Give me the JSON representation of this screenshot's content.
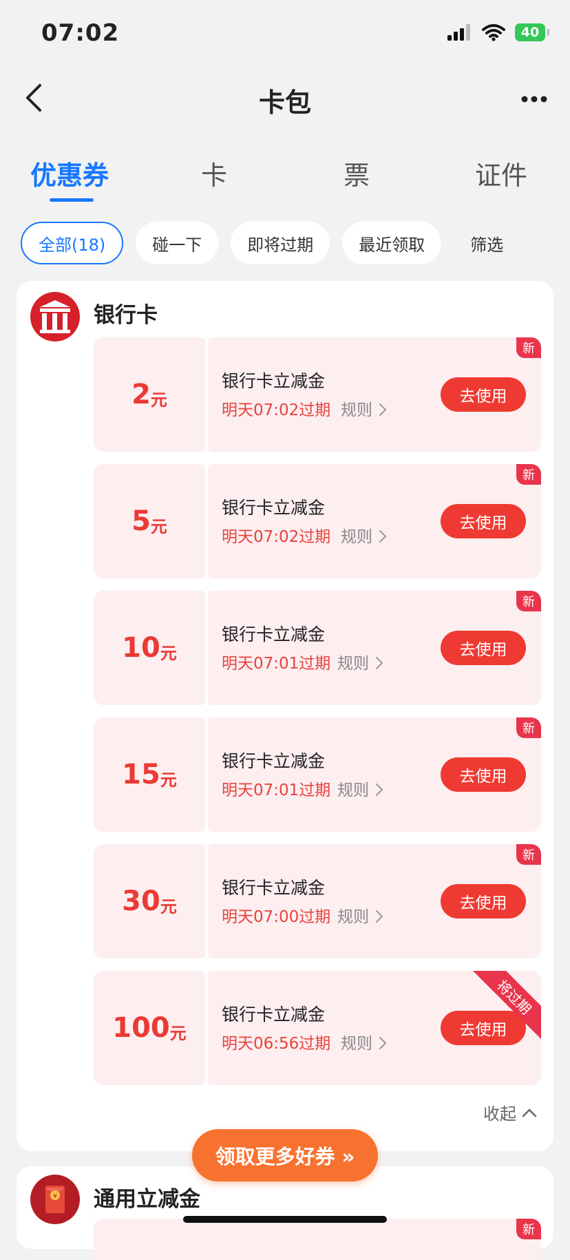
{
  "status": {
    "time": "07:02",
    "battery": "40"
  },
  "nav": {
    "title": "卡包"
  },
  "tabs": [
    {
      "label": "优惠券"
    },
    {
      "label": "卡"
    },
    {
      "label": "票"
    },
    {
      "label": "证件"
    }
  ],
  "filters": [
    {
      "label": "全部(18)"
    },
    {
      "label": "碰一下"
    },
    {
      "label": "即将过期"
    },
    {
      "label": "最近领取"
    },
    {
      "label": "筛选"
    }
  ],
  "group": {
    "title": "银行卡",
    "coupons": [
      {
        "amount": "2",
        "unit": "元",
        "name": "银行卡立减金",
        "expiry": "明天07:02过期",
        "rule": "规则",
        "button": "去使用",
        "badge": "新"
      },
      {
        "amount": "5",
        "unit": "元",
        "name": "银行卡立减金",
        "expiry": "明天07:02过期",
        "rule": "规则",
        "button": "去使用",
        "badge": "新"
      },
      {
        "amount": "10",
        "unit": "元",
        "name": "银行卡立减金",
        "expiry": "明天07:01过期",
        "rule": "规则",
        "button": "去使用",
        "badge": "新"
      },
      {
        "amount": "15",
        "unit": "元",
        "name": "银行卡立减金",
        "expiry": "明天07:01过期",
        "rule": "规则",
        "button": "去使用",
        "badge": "新"
      },
      {
        "amount": "30",
        "unit": "元",
        "name": "银行卡立减金",
        "expiry": "明天07:00过期",
        "rule": "规则",
        "button": "去使用",
        "badge": "新"
      },
      {
        "amount": "100",
        "unit": "元",
        "name": "银行卡立减金",
        "expiry": "明天06:56过期",
        "rule": "规则",
        "button": "去使用",
        "badge": "将过期"
      }
    ],
    "collapse": "收起"
  },
  "group2": {
    "title": "通用立减金",
    "badge": "新"
  },
  "more_button": "领取更多好券 »"
}
